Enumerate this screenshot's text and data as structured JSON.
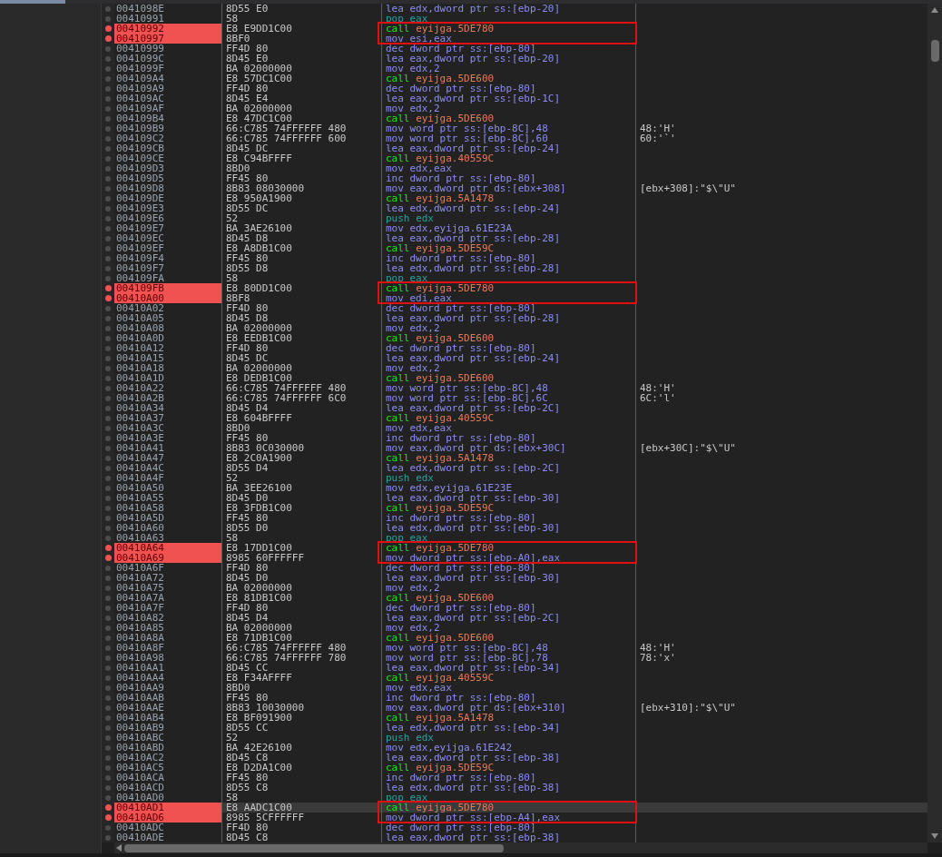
{
  "rows": [
    {
      "address": "0041098E",
      "bytes": "8D55 E0",
      "mnemonic": "lea",
      "operands": "edx,dword ptr ss:[ebp-20]",
      "kind": "op",
      "breakpoint": false,
      "boxed": false,
      "selected": false
    },
    {
      "address": "00410991",
      "bytes": "58",
      "mnemonic": "pop",
      "operands": "eax",
      "kind": "stack",
      "breakpoint": false,
      "boxed": false,
      "selected": false
    },
    {
      "address": "00410992",
      "bytes": "E8 E9DD1C00",
      "mnemonic": "call",
      "operands": "eyijga.5DE780",
      "kind": "call",
      "breakpoint": true,
      "boxed": true,
      "selected": false
    },
    {
      "address": "00410997",
      "bytes": "8BF0",
      "mnemonic": "mov",
      "operands": "esi,eax",
      "kind": "op",
      "breakpoint": true,
      "boxed": true,
      "selected": false
    },
    {
      "address": "00410999",
      "bytes": "FF4D 80",
      "mnemonic": "dec",
      "operands": "dword ptr ss:[ebp-80]",
      "kind": "op",
      "breakpoint": false,
      "boxed": false,
      "selected": false
    },
    {
      "address": "0041099C",
      "bytes": "8D45 E0",
      "mnemonic": "lea",
      "operands": "eax,dword ptr ss:[ebp-20]",
      "kind": "op",
      "breakpoint": false,
      "boxed": false,
      "selected": false
    },
    {
      "address": "0041099F",
      "bytes": "BA 02000000",
      "mnemonic": "mov",
      "operands": "edx,2",
      "kind": "op",
      "breakpoint": false,
      "boxed": false,
      "selected": false
    },
    {
      "address": "004109A4",
      "bytes": "E8 57DC1C00",
      "mnemonic": "call",
      "operands": "eyijga.5DE600",
      "kind": "call",
      "breakpoint": false,
      "boxed": false,
      "selected": false
    },
    {
      "address": "004109A9",
      "bytes": "FF4D 80",
      "mnemonic": "dec",
      "operands": "dword ptr ss:[ebp-80]",
      "kind": "op",
      "breakpoint": false,
      "boxed": false,
      "selected": false
    },
    {
      "address": "004109AC",
      "bytes": "8D45 E4",
      "mnemonic": "lea",
      "operands": "eax,dword ptr ss:[ebp-1C]",
      "kind": "op",
      "breakpoint": false,
      "boxed": false,
      "selected": false
    },
    {
      "address": "004109AF",
      "bytes": "BA 02000000",
      "mnemonic": "mov",
      "operands": "edx,2",
      "kind": "op",
      "breakpoint": false,
      "boxed": false,
      "selected": false
    },
    {
      "address": "004109B4",
      "bytes": "E8 47DC1C00",
      "mnemonic": "call",
      "operands": "eyijga.5DE600",
      "kind": "call",
      "breakpoint": false,
      "boxed": false,
      "selected": false
    },
    {
      "address": "004109B9",
      "bytes": "66:C785 74FFFFFF 480",
      "mnemonic": "mov",
      "operands": "word ptr ss:[ebp-8C],48",
      "kind": "op",
      "comment": "48:'H'",
      "breakpoint": false,
      "boxed": false,
      "selected": false
    },
    {
      "address": "004109C2",
      "bytes": "66:C785 74FFFFFF 600",
      "mnemonic": "mov",
      "operands": "word ptr ss:[ebp-8C],60",
      "kind": "op",
      "comment": "60:'`'",
      "breakpoint": false,
      "boxed": false,
      "selected": false
    },
    {
      "address": "004109CB",
      "bytes": "8D45 DC",
      "mnemonic": "lea",
      "operands": "eax,dword ptr ss:[ebp-24]",
      "kind": "op",
      "breakpoint": false,
      "boxed": false,
      "selected": false
    },
    {
      "address": "004109CE",
      "bytes": "E8 C94BFFFF",
      "mnemonic": "call",
      "operands": "eyijga.40559C",
      "kind": "call",
      "breakpoint": false,
      "boxed": false,
      "selected": false
    },
    {
      "address": "004109D3",
      "bytes": "8BD0",
      "mnemonic": "mov",
      "operands": "edx,eax",
      "kind": "op",
      "breakpoint": false,
      "boxed": false,
      "selected": false
    },
    {
      "address": "004109D5",
      "bytes": "FF45 80",
      "mnemonic": "inc",
      "operands": "dword ptr ss:[ebp-80]",
      "kind": "op",
      "breakpoint": false,
      "boxed": false,
      "selected": false
    },
    {
      "address": "004109D8",
      "bytes": "8B83 08030000",
      "mnemonic": "mov",
      "operands": "eax,dword ptr ds:[ebx+308]",
      "kind": "op",
      "comment": "[ebx+308]:\"$\\\"U\"",
      "breakpoint": false,
      "boxed": false,
      "selected": false
    },
    {
      "address": "004109DE",
      "bytes": "E8 950A1900",
      "mnemonic": "call",
      "operands": "eyijga.5A1478",
      "kind": "call",
      "breakpoint": false,
      "boxed": false,
      "selected": false
    },
    {
      "address": "004109E3",
      "bytes": "8D55 DC",
      "mnemonic": "lea",
      "operands": "edx,dword ptr ss:[ebp-24]",
      "kind": "op",
      "breakpoint": false,
      "boxed": false,
      "selected": false
    },
    {
      "address": "004109E6",
      "bytes": "52",
      "mnemonic": "push",
      "operands": "edx",
      "kind": "stack",
      "breakpoint": false,
      "boxed": false,
      "selected": false
    },
    {
      "address": "004109E7",
      "bytes": "BA 3AE26100",
      "mnemonic": "mov",
      "operands": "edx,eyijga.61E23A",
      "kind": "op",
      "breakpoint": false,
      "boxed": false,
      "selected": false
    },
    {
      "address": "004109EC",
      "bytes": "8D45 D8",
      "mnemonic": "lea",
      "operands": "eax,dword ptr ss:[ebp-28]",
      "kind": "op",
      "breakpoint": false,
      "boxed": false,
      "selected": false
    },
    {
      "address": "004109EF",
      "bytes": "E8 A8DB1C00",
      "mnemonic": "call",
      "operands": "eyijga.5DE59C",
      "kind": "call",
      "breakpoint": false,
      "boxed": false,
      "selected": false
    },
    {
      "address": "004109F4",
      "bytes": "FF45 80",
      "mnemonic": "inc",
      "operands": "dword ptr ss:[ebp-80]",
      "kind": "op",
      "breakpoint": false,
      "boxed": false,
      "selected": false
    },
    {
      "address": "004109F7",
      "bytes": "8D55 D8",
      "mnemonic": "lea",
      "operands": "edx,dword ptr ss:[ebp-28]",
      "kind": "op",
      "breakpoint": false,
      "boxed": false,
      "selected": false
    },
    {
      "address": "004109FA",
      "bytes": "58",
      "mnemonic": "pop",
      "operands": "eax",
      "kind": "stack",
      "breakpoint": false,
      "boxed": false,
      "selected": false
    },
    {
      "address": "004109FB",
      "bytes": "E8 80DD1C00",
      "mnemonic": "call",
      "operands": "eyijga.5DE780",
      "kind": "call",
      "breakpoint": true,
      "boxed": true,
      "selected": false
    },
    {
      "address": "00410A00",
      "bytes": "8BF8",
      "mnemonic": "mov",
      "operands": "edi,eax",
      "kind": "op",
      "breakpoint": true,
      "boxed": true,
      "selected": false
    },
    {
      "address": "00410A02",
      "bytes": "FF4D 80",
      "mnemonic": "dec",
      "operands": "dword ptr ss:[ebp-80]",
      "kind": "op",
      "breakpoint": false,
      "boxed": false,
      "selected": false
    },
    {
      "address": "00410A05",
      "bytes": "8D45 D8",
      "mnemonic": "lea",
      "operands": "eax,dword ptr ss:[ebp-28]",
      "kind": "op",
      "breakpoint": false,
      "boxed": false,
      "selected": false
    },
    {
      "address": "00410A08",
      "bytes": "BA 02000000",
      "mnemonic": "mov",
      "operands": "edx,2",
      "kind": "op",
      "breakpoint": false,
      "boxed": false,
      "selected": false
    },
    {
      "address": "00410A0D",
      "bytes": "E8 EEDB1C00",
      "mnemonic": "call",
      "operands": "eyijga.5DE600",
      "kind": "call",
      "breakpoint": false,
      "boxed": false,
      "selected": false
    },
    {
      "address": "00410A12",
      "bytes": "FF4D 80",
      "mnemonic": "dec",
      "operands": "dword ptr ss:[ebp-80]",
      "kind": "op",
      "breakpoint": false,
      "boxed": false,
      "selected": false
    },
    {
      "address": "00410A15",
      "bytes": "8D45 DC",
      "mnemonic": "lea",
      "operands": "eax,dword ptr ss:[ebp-24]",
      "kind": "op",
      "breakpoint": false,
      "boxed": false,
      "selected": false
    },
    {
      "address": "00410A18",
      "bytes": "BA 02000000",
      "mnemonic": "mov",
      "operands": "edx,2",
      "kind": "op",
      "breakpoint": false,
      "boxed": false,
      "selected": false
    },
    {
      "address": "00410A1D",
      "bytes": "E8 DEDB1C00",
      "mnemonic": "call",
      "operands": "eyijga.5DE600",
      "kind": "call",
      "breakpoint": false,
      "boxed": false,
      "selected": false
    },
    {
      "address": "00410A22",
      "bytes": "66:C785 74FFFFFF 480",
      "mnemonic": "mov",
      "operands": "word ptr ss:[ebp-8C],48",
      "kind": "op",
      "comment": "48:'H'",
      "breakpoint": false,
      "boxed": false,
      "selected": false
    },
    {
      "address": "00410A2B",
      "bytes": "66:C785 74FFFFFF 6C0",
      "mnemonic": "mov",
      "operands": "word ptr ss:[ebp-8C],6C",
      "kind": "op",
      "comment": "6C:'l'",
      "breakpoint": false,
      "boxed": false,
      "selected": false
    },
    {
      "address": "00410A34",
      "bytes": "8D45 D4",
      "mnemonic": "lea",
      "operands": "eax,dword ptr ss:[ebp-2C]",
      "kind": "op",
      "breakpoint": false,
      "boxed": false,
      "selected": false
    },
    {
      "address": "00410A37",
      "bytes": "E8 604BFFFF",
      "mnemonic": "call",
      "operands": "eyijga.40559C",
      "kind": "call",
      "breakpoint": false,
      "boxed": false,
      "selected": false
    },
    {
      "address": "00410A3C",
      "bytes": "8BD0",
      "mnemonic": "mov",
      "operands": "edx,eax",
      "kind": "op",
      "breakpoint": false,
      "boxed": false,
      "selected": false
    },
    {
      "address": "00410A3E",
      "bytes": "FF45 80",
      "mnemonic": "inc",
      "operands": "dword ptr ss:[ebp-80]",
      "kind": "op",
      "breakpoint": false,
      "boxed": false,
      "selected": false
    },
    {
      "address": "00410A41",
      "bytes": "8B83 0C030000",
      "mnemonic": "mov",
      "operands": "eax,dword ptr ds:[ebx+30C]",
      "kind": "op",
      "comment": "[ebx+30C]:\"$\\\"U\"",
      "breakpoint": false,
      "boxed": false,
      "selected": false
    },
    {
      "address": "00410A47",
      "bytes": "E8 2C0A1900",
      "mnemonic": "call",
      "operands": "eyijga.5A1478",
      "kind": "call",
      "breakpoint": false,
      "boxed": false,
      "selected": false
    },
    {
      "address": "00410A4C",
      "bytes": "8D55 D4",
      "mnemonic": "lea",
      "operands": "edx,dword ptr ss:[ebp-2C]",
      "kind": "op",
      "breakpoint": false,
      "boxed": false,
      "selected": false
    },
    {
      "address": "00410A4F",
      "bytes": "52",
      "mnemonic": "push",
      "operands": "edx",
      "kind": "stack",
      "breakpoint": false,
      "boxed": false,
      "selected": false
    },
    {
      "address": "00410A50",
      "bytes": "BA 3EE26100",
      "mnemonic": "mov",
      "operands": "edx,eyijga.61E23E",
      "kind": "op",
      "breakpoint": false,
      "boxed": false,
      "selected": false
    },
    {
      "address": "00410A55",
      "bytes": "8D45 D0",
      "mnemonic": "lea",
      "operands": "eax,dword ptr ss:[ebp-30]",
      "kind": "op",
      "breakpoint": false,
      "boxed": false,
      "selected": false
    },
    {
      "address": "00410A58",
      "bytes": "E8 3FDB1C00",
      "mnemonic": "call",
      "operands": "eyijga.5DE59C",
      "kind": "call",
      "breakpoint": false,
      "boxed": false,
      "selected": false
    },
    {
      "address": "00410A5D",
      "bytes": "FF45 80",
      "mnemonic": "inc",
      "operands": "dword ptr ss:[ebp-80]",
      "kind": "op",
      "breakpoint": false,
      "boxed": false,
      "selected": false
    },
    {
      "address": "00410A60",
      "bytes": "8D55 D0",
      "mnemonic": "lea",
      "operands": "edx,dword ptr ss:[ebp-30]",
      "kind": "op",
      "breakpoint": false,
      "boxed": false,
      "selected": false
    },
    {
      "address": "00410A63",
      "bytes": "58",
      "mnemonic": "pop",
      "operands": "eax",
      "kind": "stack",
      "breakpoint": false,
      "boxed": false,
      "selected": false
    },
    {
      "address": "00410A64",
      "bytes": "E8 17DD1C00",
      "mnemonic": "call",
      "operands": "eyijga.5DE780",
      "kind": "call",
      "breakpoint": true,
      "boxed": true,
      "selected": false
    },
    {
      "address": "00410A69",
      "bytes": "8985 60FFFFFF",
      "mnemonic": "mov",
      "operands": "dword ptr ss:[ebp-A0],eax",
      "kind": "op",
      "breakpoint": true,
      "boxed": true,
      "selected": false
    },
    {
      "address": "00410A6F",
      "bytes": "FF4D 80",
      "mnemonic": "dec",
      "operands": "dword ptr ss:[ebp-80]",
      "kind": "op",
      "breakpoint": false,
      "boxed": false,
      "selected": false
    },
    {
      "address": "00410A72",
      "bytes": "8D45 D0",
      "mnemonic": "lea",
      "operands": "eax,dword ptr ss:[ebp-30]",
      "kind": "op",
      "breakpoint": false,
      "boxed": false,
      "selected": false
    },
    {
      "address": "00410A75",
      "bytes": "BA 02000000",
      "mnemonic": "mov",
      "operands": "edx,2",
      "kind": "op",
      "breakpoint": false,
      "boxed": false,
      "selected": false
    },
    {
      "address": "00410A7A",
      "bytes": "E8 81DB1C00",
      "mnemonic": "call",
      "operands": "eyijga.5DE600",
      "kind": "call",
      "breakpoint": false,
      "boxed": false,
      "selected": false
    },
    {
      "address": "00410A7F",
      "bytes": "FF4D 80",
      "mnemonic": "dec",
      "operands": "dword ptr ss:[ebp-80]",
      "kind": "op",
      "breakpoint": false,
      "boxed": false,
      "selected": false
    },
    {
      "address": "00410A82",
      "bytes": "8D45 D4",
      "mnemonic": "lea",
      "operands": "eax,dword ptr ss:[ebp-2C]",
      "kind": "op",
      "breakpoint": false,
      "boxed": false,
      "selected": false
    },
    {
      "address": "00410A85",
      "bytes": "BA 02000000",
      "mnemonic": "mov",
      "operands": "edx,2",
      "kind": "op",
      "breakpoint": false,
      "boxed": false,
      "selected": false
    },
    {
      "address": "00410A8A",
      "bytes": "E8 71DB1C00",
      "mnemonic": "call",
      "operands": "eyijga.5DE600",
      "kind": "call",
      "breakpoint": false,
      "boxed": false,
      "selected": false
    },
    {
      "address": "00410A8F",
      "bytes": "66:C785 74FFFFFF 480",
      "mnemonic": "mov",
      "operands": "word ptr ss:[ebp-8C],48",
      "kind": "op",
      "comment": "48:'H'",
      "breakpoint": false,
      "boxed": false,
      "selected": false
    },
    {
      "address": "00410A98",
      "bytes": "66:C785 74FFFFFF 780",
      "mnemonic": "mov",
      "operands": "word ptr ss:[ebp-8C],78",
      "kind": "op",
      "comment": "78:'x'",
      "breakpoint": false,
      "boxed": false,
      "selected": false
    },
    {
      "address": "00410AA1",
      "bytes": "8D45 CC",
      "mnemonic": "lea",
      "operands": "eax,dword ptr ss:[ebp-34]",
      "kind": "op",
      "breakpoint": false,
      "boxed": false,
      "selected": false
    },
    {
      "address": "00410AA4",
      "bytes": "E8 F34AFFFF",
      "mnemonic": "call",
      "operands": "eyijga.40559C",
      "kind": "call",
      "breakpoint": false,
      "boxed": false,
      "selected": false
    },
    {
      "address": "00410AA9",
      "bytes": "8BD0",
      "mnemonic": "mov",
      "operands": "edx,eax",
      "kind": "op",
      "breakpoint": false,
      "boxed": false,
      "selected": false
    },
    {
      "address": "00410AAB",
      "bytes": "FF45 80",
      "mnemonic": "inc",
      "operands": "dword ptr ss:[ebp-80]",
      "kind": "op",
      "breakpoint": false,
      "boxed": false,
      "selected": false
    },
    {
      "address": "00410AAE",
      "bytes": "8B83 10030000",
      "mnemonic": "mov",
      "operands": "eax,dword ptr ds:[ebx+310]",
      "kind": "op",
      "comment": "[ebx+310]:\"$\\\"U\"",
      "breakpoint": false,
      "boxed": false,
      "selected": false
    },
    {
      "address": "00410AB4",
      "bytes": "E8 BF091900",
      "mnemonic": "call",
      "operands": "eyijga.5A1478",
      "kind": "call",
      "breakpoint": false,
      "boxed": false,
      "selected": false
    },
    {
      "address": "00410AB9",
      "bytes": "8D55 CC",
      "mnemonic": "lea",
      "operands": "edx,dword ptr ss:[ebp-34]",
      "kind": "op",
      "breakpoint": false,
      "boxed": false,
      "selected": false
    },
    {
      "address": "00410ABC",
      "bytes": "52",
      "mnemonic": "push",
      "operands": "edx",
      "kind": "stack",
      "breakpoint": false,
      "boxed": false,
      "selected": false
    },
    {
      "address": "00410ABD",
      "bytes": "BA 42E26100",
      "mnemonic": "mov",
      "operands": "edx,eyijga.61E242",
      "kind": "op",
      "breakpoint": false,
      "boxed": false,
      "selected": false
    },
    {
      "address": "00410AC2",
      "bytes": "8D45 C8",
      "mnemonic": "lea",
      "operands": "eax,dword ptr ss:[ebp-38]",
      "kind": "op",
      "breakpoint": false,
      "boxed": false,
      "selected": false
    },
    {
      "address": "00410AC5",
      "bytes": "E8 D2DA1C00",
      "mnemonic": "call",
      "operands": "eyijga.5DE59C",
      "kind": "call",
      "breakpoint": false,
      "boxed": false,
      "selected": false
    },
    {
      "address": "00410ACA",
      "bytes": "FF45 80",
      "mnemonic": "inc",
      "operands": "dword ptr ss:[ebp-80]",
      "kind": "op",
      "breakpoint": false,
      "boxed": false,
      "selected": false
    },
    {
      "address": "00410ACD",
      "bytes": "8D55 C8",
      "mnemonic": "lea",
      "operands": "edx,dword ptr ss:[ebp-38]",
      "kind": "op",
      "breakpoint": false,
      "boxed": false,
      "selected": false
    },
    {
      "address": "00410AD0",
      "bytes": "58",
      "mnemonic": "pop",
      "operands": "eax",
      "kind": "stack",
      "breakpoint": false,
      "boxed": false,
      "selected": false
    },
    {
      "address": "00410AD1",
      "bytes": "E8 AADC1C00",
      "mnemonic": "call",
      "operands": "eyijga.5DE780",
      "kind": "call",
      "breakpoint": true,
      "boxed": true,
      "selected": true
    },
    {
      "address": "00410AD6",
      "bytes": "8985 5CFFFFFF",
      "mnemonic": "mov",
      "operands": "dword ptr ss:[ebp-A4],eax",
      "kind": "op",
      "breakpoint": true,
      "boxed": true,
      "selected": false
    },
    {
      "address": "00410ADC",
      "bytes": "FF4D 80",
      "mnemonic": "dec",
      "operands": "dword ptr ss:[ebp-80]",
      "kind": "op",
      "breakpoint": false,
      "boxed": false,
      "selected": false
    },
    {
      "address": "00410ADE",
      "bytes": "8D45 C8",
      "mnemonic": "lea",
      "operands": "eax,dword ptr ss:[ebp-38]",
      "kind": "op",
      "breakpoint": false,
      "boxed": false,
      "selected": false
    }
  ]
}
